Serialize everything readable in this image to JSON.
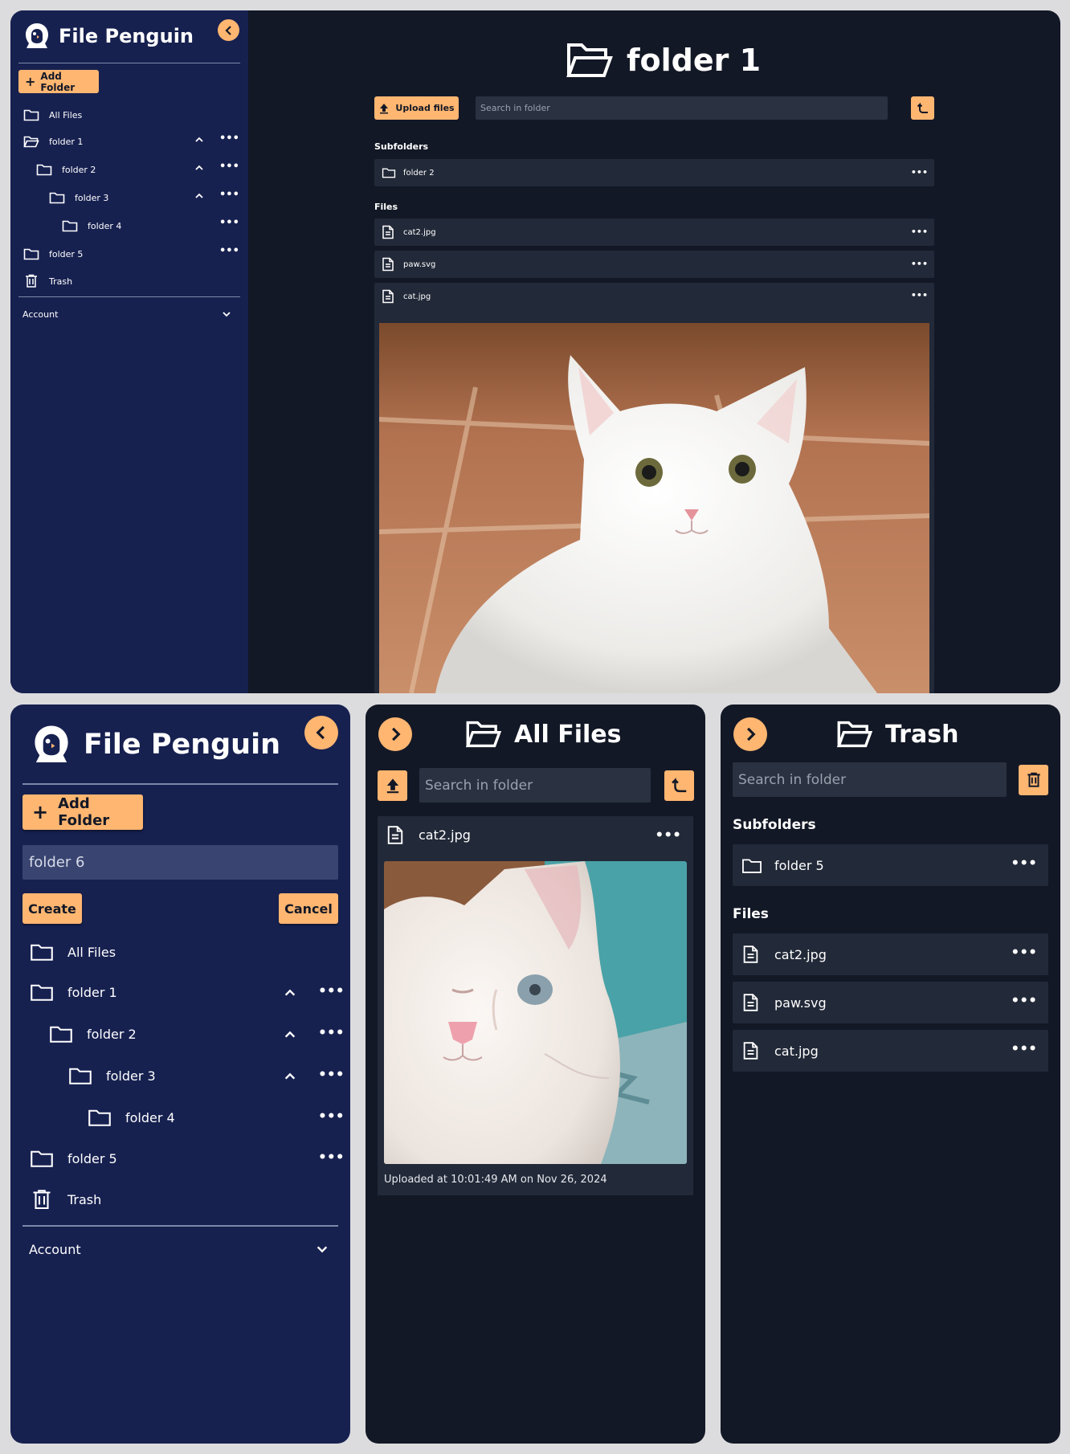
{
  "app": {
    "name": "File Penguin"
  },
  "sidebar": {
    "add_folder_label": "Add Folder",
    "items": [
      {
        "label": "All Files",
        "icon": "folder-icon"
      },
      {
        "label": "folder 1",
        "icon": "folder-open-icon"
      },
      {
        "label": "folder 2",
        "icon": "folder-icon"
      },
      {
        "label": "folder 3",
        "icon": "folder-icon"
      },
      {
        "label": "folder 4",
        "icon": "folder-icon"
      },
      {
        "label": "folder 5",
        "icon": "folder-icon"
      },
      {
        "label": "Trash",
        "icon": "trash-icon"
      }
    ],
    "account_label": "Account"
  },
  "folder_view": {
    "title": "folder 1",
    "upload_label": "Upload files",
    "search_placeholder": "Search in folder",
    "subfolders_label": "Subfolders",
    "subfolders": [
      "folder 2"
    ],
    "files_label": "Files",
    "files": [
      "cat2.jpg",
      "paw.svg",
      "cat.jpg"
    ]
  },
  "new_folder_form": {
    "input_value": "folder 6",
    "create_label": "Create",
    "cancel_label": "Cancel"
  },
  "all_files_view": {
    "title": "All Files",
    "search_placeholder": "Search in folder",
    "file_name": "cat2.jpg",
    "uploaded_caption": "Uploaded at 10:01:49 AM on Nov 26, 2024"
  },
  "trash_view": {
    "title": "Trash",
    "search_placeholder": "Search in folder",
    "subfolders_label": "Subfolders",
    "subfolders": [
      "folder 5"
    ],
    "files_label": "Files",
    "files": [
      "cat2.jpg",
      "paw.svg",
      "cat.jpg"
    ]
  },
  "colors": {
    "accent": "#ffb671",
    "sidebar_bg": "#172150",
    "main_bg": "#131826",
    "row_bg": "#222938"
  }
}
